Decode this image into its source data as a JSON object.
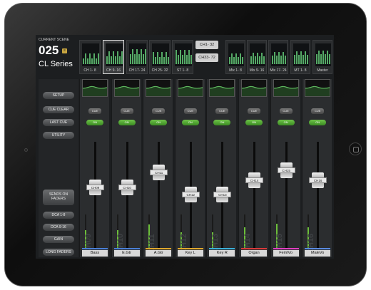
{
  "scene": {
    "label": "CURRENT SCENE",
    "number": "025",
    "name": "CL Series"
  },
  "banks": [
    {
      "label": "CH 1- 8",
      "selected": false
    },
    {
      "label": "CH 9- 16",
      "selected": true
    },
    {
      "label": "CH 17- 24",
      "selected": false
    },
    {
      "label": "CH 25- 32",
      "selected": false
    },
    {
      "label": "ST 1- 8",
      "selected": false
    }
  ],
  "channel_range": [
    "CH1- 32",
    "CH33- 72"
  ],
  "mix_banks": [
    {
      "label": "Mix 1- 8"
    },
    {
      "label": "Mix 9- 16"
    },
    {
      "label": "Mix 17- 24"
    },
    {
      "label": "MT 1- 8"
    },
    {
      "label": "Master"
    }
  ],
  "sidebar": {
    "setup": "SETUP",
    "cue_clear": "CUE CLEAR",
    "last_cue": "LAST CUE",
    "utility": "UTILITY",
    "sends": "SENDS ON FADERS",
    "dca1": "DCA 1-8",
    "dca9": "DCA 9-16",
    "gain": "GAIN",
    "long": "LONG FADERS"
  },
  "strips": [
    {
      "ch": "CH09",
      "name": "Bass",
      "color": "#4a7fd6",
      "level": 0.55
    },
    {
      "ch": "CH10",
      "name": "E.Gtr",
      "color": "#4a7fd6",
      "level": 0.55
    },
    {
      "ch": "CH11",
      "name": "A.Gtr",
      "color": "#e0a82e",
      "level": 0.7
    },
    {
      "ch": "CH12",
      "name": "Key L",
      "color": "#e0a82e",
      "level": 0.48
    },
    {
      "ch": "CH13",
      "name": "Key R",
      "color": "#3bb0d8",
      "level": 0.48
    },
    {
      "ch": "CH14",
      "name": "Organ",
      "color": "#d83b3b",
      "level": 0.62
    },
    {
      "ch": "CH15",
      "name": "FemlVo",
      "color": "#e040c0",
      "level": 0.72
    },
    {
      "ch": "CH16",
      "name": "MaleVo",
      "color": "#5a8ae0",
      "level": 0.62
    }
  ],
  "labels": {
    "cue": "CUE",
    "on": "ON"
  }
}
